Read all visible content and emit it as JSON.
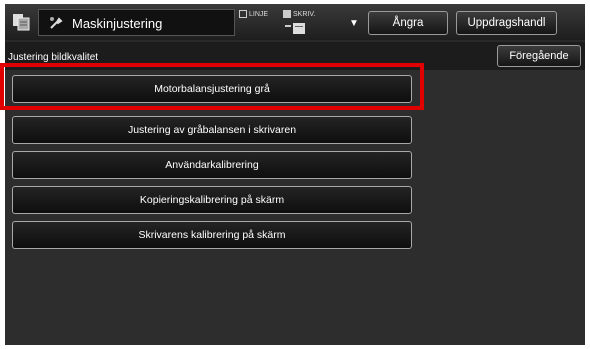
{
  "header": {
    "title": "Maskinjustering",
    "mode_line_label": "LINJE",
    "mode_print_label": "SKRIV.",
    "undo_label": "Ångra",
    "jobs_label": "Uppdragshandl"
  },
  "subheader": {
    "breadcrumb": "Justering bildkvalitet",
    "back_label": "Föregående"
  },
  "menu": {
    "items": [
      {
        "label": "Motorbalansjustering grå",
        "highlighted": true
      },
      {
        "label": "Justering av gråbalansen i skrivaren"
      },
      {
        "label": "Användarkalibrering"
      },
      {
        "label": "Kopieringskalibrering på skärm"
      },
      {
        "label": "Skrivarens kalibrering på skärm"
      }
    ]
  },
  "colors": {
    "highlight": "#e00000",
    "background": "#2d2d2d"
  }
}
